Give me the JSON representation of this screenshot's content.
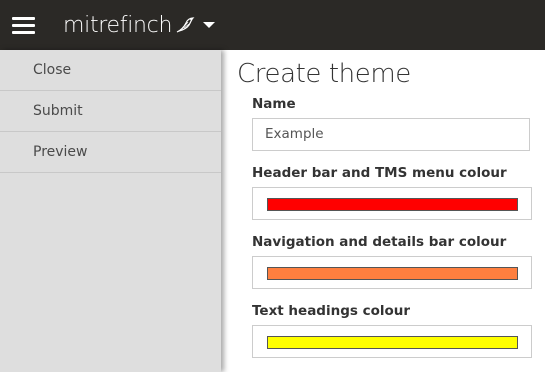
{
  "header": {
    "brand": "mitrefinch",
    "menu_icon": "hamburger-menu-icon",
    "brand_icon": "bird-icon",
    "dropdown_icon": "caret-down-icon",
    "background": "#2b2926"
  },
  "sidebar": {
    "items": [
      {
        "label": "Close"
      },
      {
        "label": "Submit"
      },
      {
        "label": "Preview"
      }
    ]
  },
  "main": {
    "title": "Create theme",
    "fields": [
      {
        "label": "Name",
        "type": "text",
        "value": "Example"
      },
      {
        "label": "Header bar and TMS menu colour",
        "type": "color",
        "color": "#ff0000"
      },
      {
        "label": "Navigation and details bar colour",
        "type": "color",
        "color": "#ff7f3f"
      },
      {
        "label": "Text headings colour",
        "type": "color",
        "color": "#ffff00"
      }
    ]
  }
}
